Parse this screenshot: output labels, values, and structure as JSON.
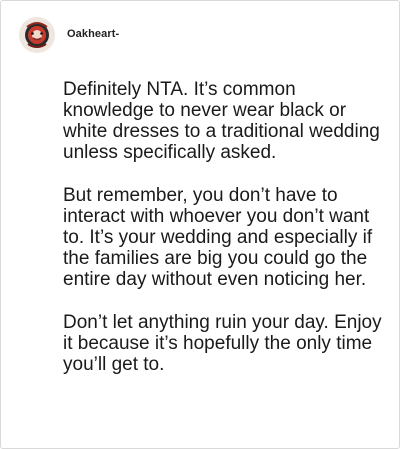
{
  "post": {
    "username": "Oakheart-",
    "avatar_icon": "avatar-icon",
    "paragraphs": [
      "Definitely NTA. It’s common knowledge to never wear black or white dresses to a traditional wedding unless specifically asked.",
      "But remember, you don’t have to interact with whoever you don’t want to. It’s your wedding and especially if the families are big you could go the entire day without even noticing her.",
      "Don’t let anything ruin your day. Enjoy it because it’s hopefully the only time you’ll get to."
    ]
  },
  "colors": {
    "border": "#d9d9d9",
    "text": "#1a1a1a",
    "username": "#222222"
  }
}
